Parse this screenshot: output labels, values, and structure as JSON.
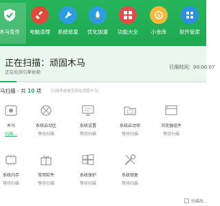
{
  "nav": {
    "items": [
      {
        "label": "木马查杀",
        "icon": "shield-icon",
        "color": "#ffffff"
      },
      {
        "label": "电脑清理",
        "icon": "broom-icon",
        "color": "#e04a3b"
      },
      {
        "label": "系统修复",
        "icon": "wrench-icon",
        "color": "#2c9de0"
      },
      {
        "label": "优化加速",
        "icon": "rocket-icon",
        "color": "#f0a52a"
      },
      {
        "label": "功能大全",
        "icon": "grid-icon",
        "color": "#e84a4a"
      },
      {
        "label": "小金库",
        "icon": "coin-icon",
        "color": "#f5b83b"
      },
      {
        "label": "软件管家",
        "icon": "apps-icon",
        "color": "#2d8fe0"
      }
    ]
  },
  "status": {
    "title": "正在扫描：顽固木马",
    "subtitle": "正在检测引擎依赖",
    "elapsed": "已用时间：00:00:07",
    "progress": 0.08
  },
  "section": {
    "title_prefix": "马扫描 - 共 ",
    "count": "10",
    "title_suffix": " 项",
    "note": "（扫描系统是否存在顽固木马）"
  },
  "items": [
    {
      "name": "木马",
      "status": "扫描...",
      "icon": "trojan-icon",
      "active": true
    },
    {
      "name": "系统启动区",
      "status": "等待扫描",
      "icon": "boot-icon"
    },
    {
      "name": "系统设置",
      "status": "等待扫描",
      "icon": "monitor-icon"
    },
    {
      "name": "系统启动项",
      "status": "等待扫描",
      "icon": "startup-folder-icon"
    },
    {
      "name": "浏览器组件",
      "status": "等待扫描",
      "icon": "browser-icon"
    },
    {
      "name": "系统内存",
      "status": "等待扫描",
      "icon": "memory-icon"
    },
    {
      "name": "常用软件",
      "status": "等待扫描",
      "icon": "gift-icon"
    },
    {
      "name": "系统保护",
      "status": "等待扫描",
      "icon": "windows-icon"
    },
    {
      "name": "系统修复",
      "status": "等待扫描",
      "icon": "tools-icon"
    }
  ],
  "bottom": {
    "checkbox_label": "扫描后..."
  }
}
